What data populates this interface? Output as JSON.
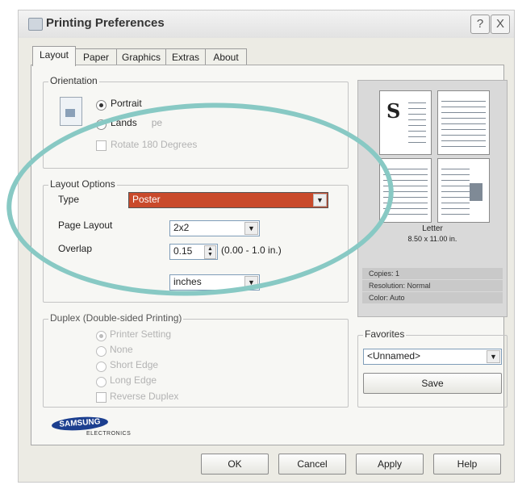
{
  "window": {
    "title": "Printing Preferences",
    "help_glyph": "?",
    "close_glyph": "X"
  },
  "tabs": [
    "Layout",
    "Paper",
    "Graphics",
    "Extras",
    "About"
  ],
  "orientation": {
    "legend": "Orientation",
    "portrait": "Portrait",
    "landscape_visible": "Lands",
    "landscape_tail": "pe",
    "rotate": "Rotate 180 Degrees"
  },
  "layout_options": {
    "legend": "Layout Options",
    "type_label": "Type",
    "type_value": "Poster",
    "page_layout_label": "Page Layout",
    "page_layout_value": "2x2",
    "overlap_label": "Overlap",
    "overlap_value": "0.15",
    "overlap_range": "(0.00 - 1.0 in.)",
    "unit_value": "inches"
  },
  "duplex": {
    "legend": "Duplex (Double-sided Printing)",
    "options": [
      "Printer Setting",
      "None",
      "Short Edge",
      "Long Edge"
    ],
    "reverse": "Reverse Duplex"
  },
  "preview": {
    "paper_name": "Letter",
    "paper_size": "8.50 x 11.00 in.",
    "copies": "Copies: 1",
    "resolution": "Resolution: Normal",
    "color": "Color: Auto",
    "glyph": "S"
  },
  "favorites": {
    "legend": "Favorites",
    "value": "<Unnamed>",
    "save_label": "Save"
  },
  "brand": {
    "name": "SAMSUNG",
    "sub": "ELECTRONICS",
    "color": "#1c3f8f"
  },
  "buttons": {
    "ok": "OK",
    "cancel": "Cancel",
    "apply": "Apply",
    "help": "Help"
  },
  "highlight_color": "#88c9c4"
}
